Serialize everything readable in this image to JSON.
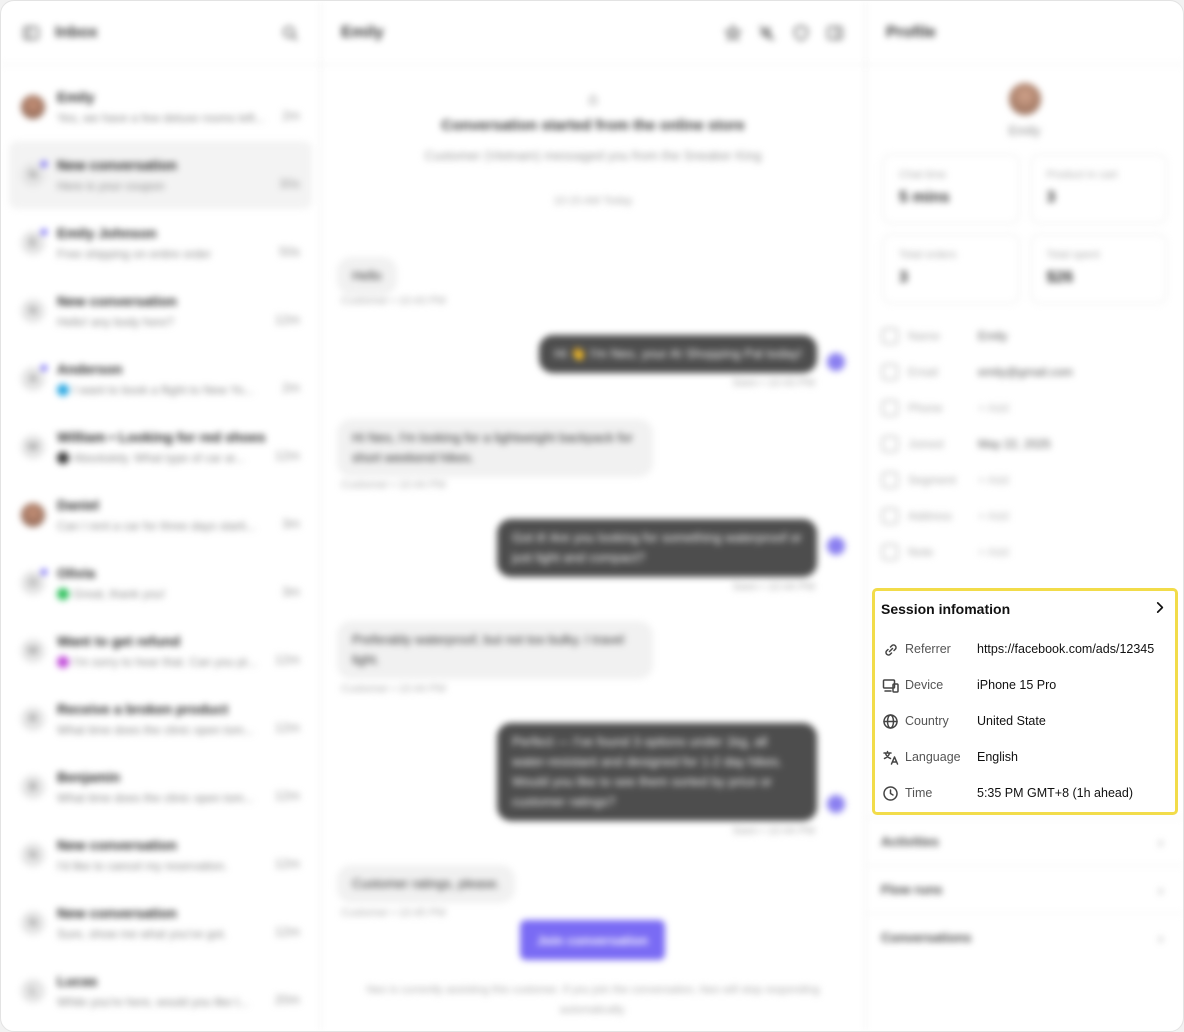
{
  "inbox": {
    "title": "Inbox",
    "conversations": [
      {
        "name": "Emily",
        "snippet": "Yes, we have a few deluxe rooms left...",
        "time": "2m",
        "initial": "",
        "channel": ""
      },
      {
        "name": "New conversation",
        "snippet": "Here is your coupon",
        "time": "30s",
        "initial": "N",
        "channel": ""
      },
      {
        "name": "Emily Johnson",
        "snippet": "Free shipping on entire order",
        "time": "50s",
        "initial": "E",
        "channel": ""
      },
      {
        "name": "New conversation",
        "snippet": "Hello! any body here?",
        "time": "12m",
        "initial": "N",
        "channel": ""
      },
      {
        "name": "Anderson",
        "snippet": "I want to book a flight to New Yo...",
        "time": "2m",
        "initial": "A",
        "channel": "#29a7e1"
      },
      {
        "name": "William • Looking for red shoes",
        "snippet": "Absolutely. What type of car ar...",
        "time": "12m",
        "initial": "W",
        "channel": "#333333"
      },
      {
        "name": "Daniel",
        "snippet": "Can I rent a car for three days starti...",
        "time": "3m",
        "initial": "",
        "channel": ""
      },
      {
        "name": "Olivia",
        "snippet": "Great, thank you!",
        "time": "3m",
        "initial": "O",
        "channel": "#2bbf5a"
      },
      {
        "name": "Want to get refund",
        "snippet": "I'm sorry to hear that. Can you pl...",
        "time": "12m",
        "initial": "W",
        "channel": "#c04bd8"
      },
      {
        "name": "Receive a broken product",
        "snippet": "What time does the clinic open tom...",
        "time": "12m",
        "initial": "R",
        "channel": ""
      },
      {
        "name": "Benjamin",
        "snippet": "What time does the clinic open tom...",
        "time": "12m",
        "initial": "B",
        "channel": ""
      },
      {
        "name": "New conversation",
        "snippet": "I'd like to cancel my reservation.",
        "time": "12m",
        "initial": "N",
        "channel": ""
      },
      {
        "name": "New conversation",
        "snippet": "Sure, show me what you've got.",
        "time": "12m",
        "initial": "N",
        "channel": ""
      },
      {
        "name": "Lucas",
        "snippet": "While you're here, would you like t...",
        "time": "20m",
        "initial": "L",
        "channel": ""
      }
    ]
  },
  "chat": {
    "title": "Emily",
    "heading": "Conversation started from the online store",
    "subheading": "Customer (Vietnam) messaged you from the Sneaker King",
    "date": "10:15 AM Today",
    "messages": [
      {
        "dir": "in",
        "text": "Hello",
        "meta": "Customer  •  10:43 PM"
      },
      {
        "dir": "out",
        "text": "Hi 👋 I'm Neo, your AI Shopping Pal today!",
        "meta": "Seen  •  10:43 PM"
      },
      {
        "dir": "in",
        "text": "Hi Neo, I'm looking for a lightweight backpack for short weekend hikes.",
        "meta": "Customer  •  10:44 PM"
      },
      {
        "dir": "out",
        "text": "Got it! Are you looking for something waterproof or just light and compact?",
        "meta": "Seen  •  10:44 PM"
      },
      {
        "dir": "in",
        "text": "Preferably waterproof, but not too bulky. I travel light.",
        "meta": "Customer  •  10:44 PM"
      },
      {
        "dir": "out",
        "text": "Perfect — I've found 3 options under 1kg, all water-resistant and designed for 1-2 day hikes. Would you like to see them sorted by price or customer ratings?",
        "meta": "Seen  •  10:44 PM"
      },
      {
        "dir": "in",
        "text": "Customer ratings, please.",
        "meta": "Customer  •  10:45 PM"
      }
    ],
    "join_label": "Join conversation",
    "notice": "Neo is currently assisting this customer. If you join the conversation, Neo will stop responding automatically."
  },
  "profile": {
    "title": "Profile",
    "name": "Emily",
    "stats": [
      {
        "label": "Chat time",
        "value": "5 mins"
      },
      {
        "label": "Product in cart",
        "value": "3"
      },
      {
        "label": "Total orders",
        "value": "3"
      },
      {
        "label": "Total spent",
        "value": "$26"
      }
    ],
    "fields": [
      {
        "label": "Name",
        "value": "Emily",
        "add": false
      },
      {
        "label": "Email",
        "value": "emily@gmail.com",
        "add": false
      },
      {
        "label": "Phone",
        "value": "+ Add",
        "add": true
      },
      {
        "label": "Joined",
        "value": "May 22, 2025",
        "add": false
      },
      {
        "label": "Segment",
        "value": "+ Add",
        "add": true
      },
      {
        "label": "Address",
        "value": "+ Add",
        "add": true
      },
      {
        "label": "Note",
        "value": "+ Add",
        "add": true
      }
    ],
    "session": {
      "title": "Session infomation",
      "rows": [
        {
          "icon": "link-icon",
          "label": "Referrer",
          "value": "https://facebook.com/ads/12345"
        },
        {
          "icon": "device-icon",
          "label": "Device",
          "value": "iPhone 15 Pro"
        },
        {
          "icon": "globe-icon",
          "label": "Country",
          "value": "United State"
        },
        {
          "icon": "translate-icon",
          "label": "Language",
          "value": "English"
        },
        {
          "icon": "clock-icon",
          "label": "Time",
          "value": "5:35 PM GMT+8 (1h ahead)"
        }
      ]
    },
    "sections": [
      "Activities",
      "Flow runs",
      "Conversations"
    ]
  },
  "colors": {
    "accent": "#7a6bf4",
    "highlight": "#f2dc4a",
    "agent_bubble": "#4d4d4d"
  }
}
